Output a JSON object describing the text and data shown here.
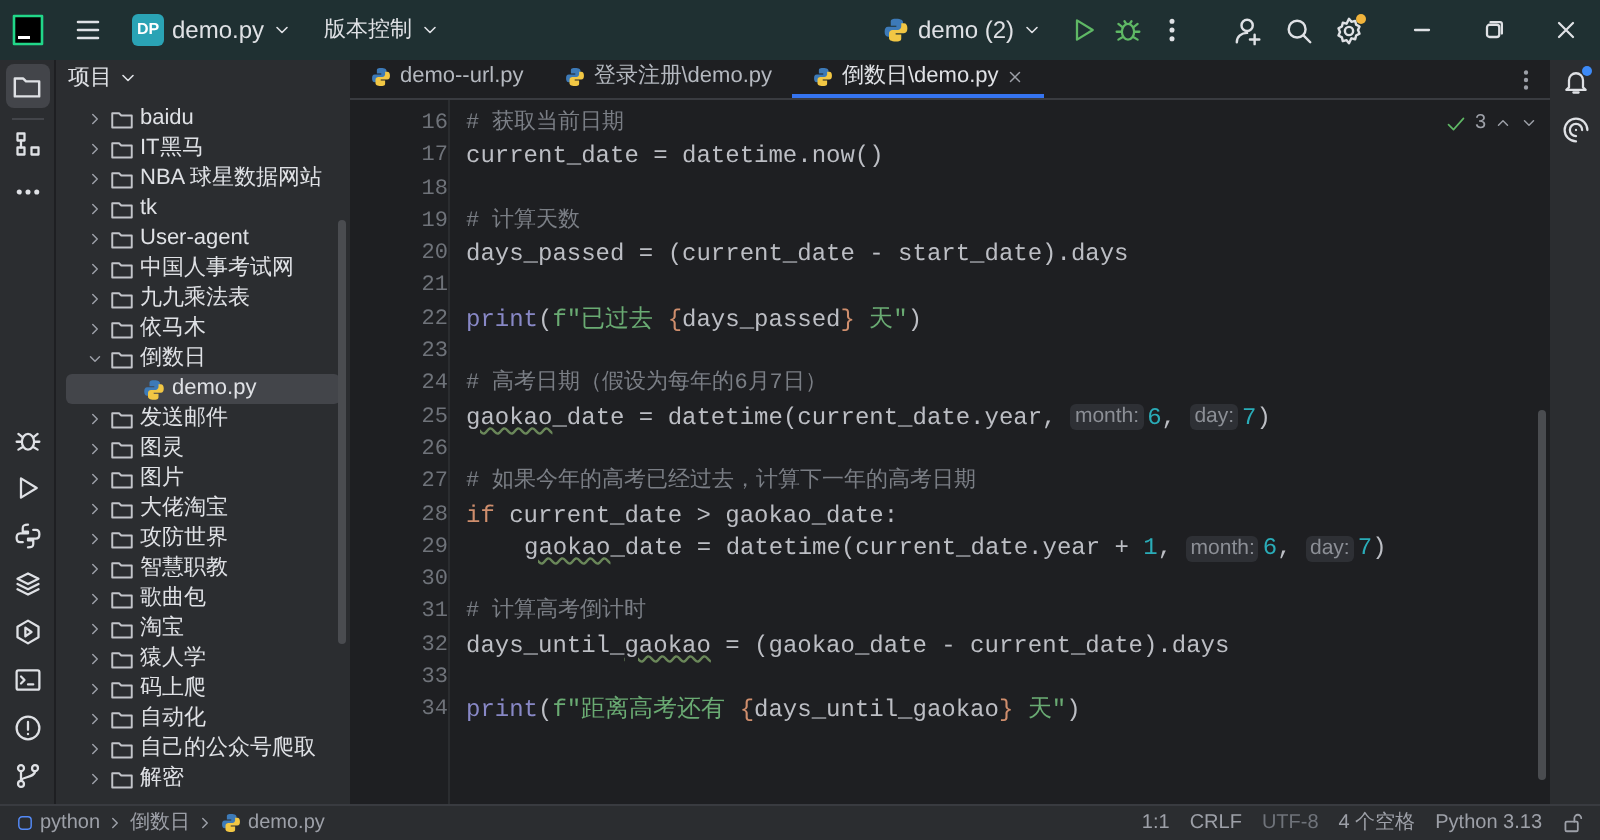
{
  "title_bar": {
    "project_badge": "DP",
    "project": "demo.py",
    "vcs": "版本控制",
    "run_config": "demo (2)"
  },
  "project_panel": {
    "title": "项目",
    "tree": [
      {
        "name": "baidu",
        "expanded": false
      },
      {
        "name": "IT黑马",
        "expanded": false
      },
      {
        "name": "NBA 球星数据网站",
        "expanded": false
      },
      {
        "name": "tk",
        "expanded": false
      },
      {
        "name": "User-agent",
        "expanded": false
      },
      {
        "name": "中国人事考试网",
        "expanded": false
      },
      {
        "name": "九九乘法表",
        "expanded": false
      },
      {
        "name": "依马木",
        "expanded": false
      },
      {
        "name": "倒数日",
        "expanded": true,
        "children": [
          {
            "name": "demo.py",
            "kind": "python",
            "selected": true
          }
        ]
      },
      {
        "name": "发送邮件",
        "expanded": false
      },
      {
        "name": "图灵",
        "expanded": false
      },
      {
        "name": "图片",
        "expanded": false
      },
      {
        "name": "大佬淘宝",
        "expanded": false
      },
      {
        "name": "攻防世界",
        "expanded": false
      },
      {
        "name": "智慧职教",
        "expanded": false
      },
      {
        "name": "歌曲包",
        "expanded": false
      },
      {
        "name": "淘宝",
        "expanded": false
      },
      {
        "name": "猿人学",
        "expanded": false
      },
      {
        "name": "码上爬",
        "expanded": false
      },
      {
        "name": "自动化",
        "expanded": false
      },
      {
        "name": "自己的公众号爬取",
        "expanded": false
      },
      {
        "name": "解密",
        "expanded": false
      }
    ]
  },
  "tabs": [
    {
      "label": "demo--url.py",
      "selected": false
    },
    {
      "label": "登录注册\\demo.py",
      "selected": false
    },
    {
      "label": "倒数日\\demo.py",
      "selected": true
    }
  ],
  "inspections": "3",
  "code_lines": [
    {
      "number": "16",
      "tokens": [
        {
          "kind": "comment",
          "text": "# 获取当前日期"
        }
      ]
    },
    {
      "number": "17",
      "tokens": [
        {
          "kind": "plain",
          "text": "current_date = datetime.now()"
        }
      ]
    },
    {
      "number": "18"
    },
    {
      "number": "19",
      "tokens": [
        {
          "kind": "comment",
          "text": "# 计算天数"
        }
      ]
    },
    {
      "number": "20",
      "tokens": [
        {
          "kind": "plain",
          "text": "days_passed = (current_date - start_date).days"
        }
      ]
    },
    {
      "number": "21"
    },
    {
      "number": "22",
      "tokens": [
        {
          "kind": "builtin",
          "text": "print"
        },
        {
          "kind": "plain",
          "text": "("
        },
        {
          "kind": "string",
          "text": "f\"已过去 "
        },
        {
          "kind": "brace",
          "text": "{"
        },
        {
          "kind": "plain",
          "text": "days_passed"
        },
        {
          "kind": "brace",
          "text": "}"
        },
        {
          "kind": "string",
          "text": " 天\""
        },
        {
          "kind": "plain",
          "text": ")"
        }
      ]
    },
    {
      "number": "23"
    },
    {
      "number": "24",
      "tokens": [
        {
          "kind": "comment",
          "text": "# 高考日期（假设为每年的6月7日）"
        }
      ]
    },
    {
      "number": "25",
      "tokens": [
        {
          "kind": "warn",
          "text": "gaokao"
        },
        {
          "kind": "plain",
          "text": "_date = datetime(current_date.year, "
        },
        {
          "kind": "hint",
          "text": "month:"
        },
        {
          "kind": "number",
          "text": "6"
        },
        {
          "kind": "plain",
          "text": ", "
        },
        {
          "kind": "hint",
          "text": "day:"
        },
        {
          "kind": "number",
          "text": "7"
        },
        {
          "kind": "plain",
          "text": ")"
        }
      ]
    },
    {
      "number": "26"
    },
    {
      "number": "27",
      "tokens": [
        {
          "kind": "comment",
          "text": "# 如果今年的高考已经过去，计算下一年的高考日期"
        }
      ]
    },
    {
      "number": "28",
      "tokens": [
        {
          "kind": "keyword",
          "text": "if"
        },
        {
          "kind": "plain",
          "text": " current_date > gaokao_date:"
        }
      ]
    },
    {
      "number": "29",
      "indented": true,
      "tokens": [
        {
          "kind": "warn",
          "text": "gaokao"
        },
        {
          "kind": "plain",
          "text": "_date = datetime(current_date.year + "
        },
        {
          "kind": "number",
          "text": "1"
        },
        {
          "kind": "plain",
          "text": ", "
        },
        {
          "kind": "hint",
          "text": "month:"
        },
        {
          "kind": "number",
          "text": "6"
        },
        {
          "kind": "plain",
          "text": ", "
        },
        {
          "kind": "hint",
          "text": "day:"
        },
        {
          "kind": "number",
          "text": "7"
        },
        {
          "kind": "plain",
          "text": ")"
        }
      ]
    },
    {
      "number": "30"
    },
    {
      "number": "31",
      "tokens": [
        {
          "kind": "comment",
          "text": "# 计算高考倒计时"
        }
      ]
    },
    {
      "number": "32",
      "tokens": [
        {
          "kind": "plain",
          "text": "days_until_"
        },
        {
          "kind": "warn",
          "text": "gaokao"
        },
        {
          "kind": "plain",
          "text": " = (gaokao_date - current_date).days"
        }
      ]
    },
    {
      "number": "33"
    },
    {
      "number": "34",
      "tokens": [
        {
          "kind": "builtin",
          "text": "print"
        },
        {
          "kind": "plain",
          "text": "("
        },
        {
          "kind": "string",
          "text": "f\"距离高考还有 "
        },
        {
          "kind": "brace",
          "text": "{"
        },
        {
          "kind": "plain",
          "text": "days_until_gaokao"
        },
        {
          "kind": "brace",
          "text": "}"
        },
        {
          "kind": "string",
          "text": " 天\""
        },
        {
          "kind": "plain",
          "text": ")"
        }
      ]
    }
  ],
  "status_bar": {
    "breadcrumbs": [
      "python",
      "倒数日",
      "demo.py"
    ],
    "position": "1:1",
    "line_ending": "CRLF",
    "encoding": "UTF-8",
    "indent": "4 个空格",
    "interpreter": "Python 3.13"
  }
}
